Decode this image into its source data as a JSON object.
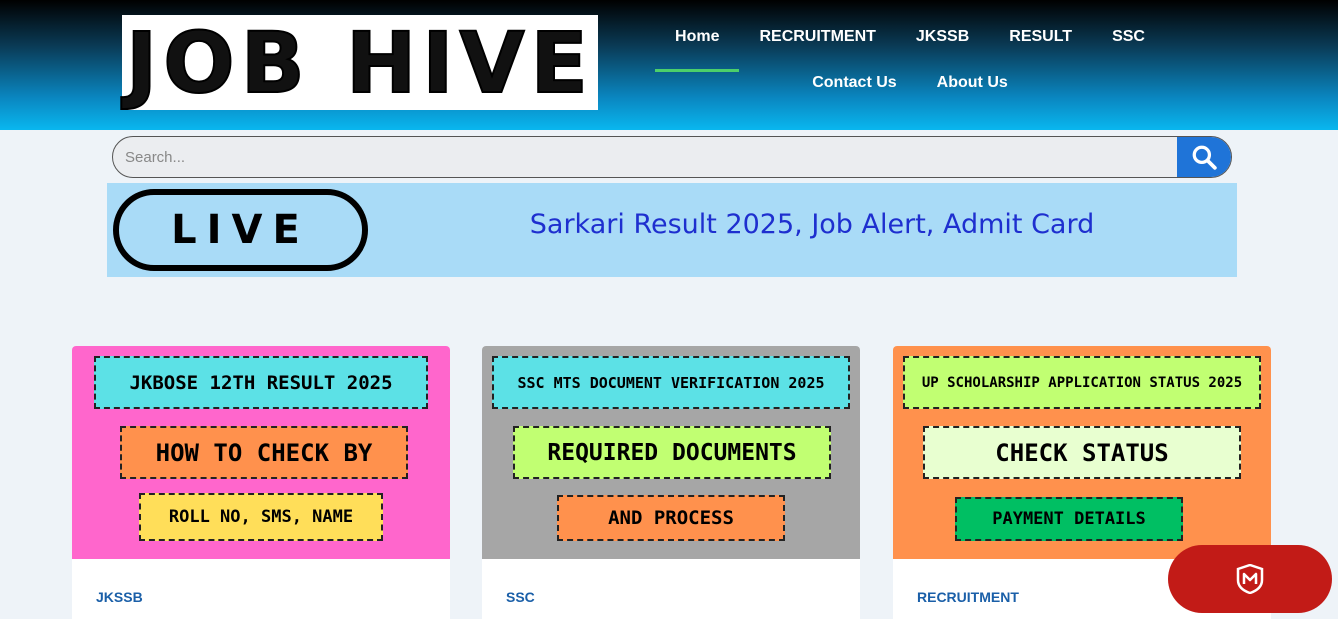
{
  "header": {
    "logo_text": "JOB HIVE",
    "nav_row1": [
      "Home",
      "RECRUITMENT",
      "JKSSB",
      "RESULT",
      "SSC"
    ],
    "nav_row2": [
      "Contact Us",
      "About Us"
    ],
    "active": "Home"
  },
  "search": {
    "placeholder": "Search...",
    "button_icon": "search-icon"
  },
  "banner": {
    "live_text": "LIVE",
    "title": "Sarkari Result 2025, Job Alert, Admit Card"
  },
  "cards": [
    {
      "bg": "#ff66cc",
      "tag1": "JKBOSE 12TH RESULT 2025",
      "tag2": "HOW TO CHECK BY",
      "tag3": "ROLL NO, SMS, NAME",
      "category": "JKSSB"
    },
    {
      "bg": "#a6a6a6",
      "tag1": "SSC MTS DOCUMENT VERIFICATION 2025",
      "tag2": "REQUIRED DOCUMENTS",
      "tag3": "AND PROCESS",
      "category": "SSC"
    },
    {
      "bg": "#ff914d",
      "tag1": "UP SCHOLARSHIP APPLICATION STATUS 2025",
      "tag2": "CHECK STATUS",
      "tag3": "PAYMENT DETAILS",
      "category": "RECRUITMENT"
    }
  ],
  "float_button": {
    "icon": "shield-m-icon"
  },
  "colors": {
    "accent_blue": "#1f74d8",
    "nav_underline": "#4ccf6a",
    "banner_bg": "#a9dbf7",
    "banner_title": "#1e2fcf",
    "float_red": "#c21b17"
  }
}
